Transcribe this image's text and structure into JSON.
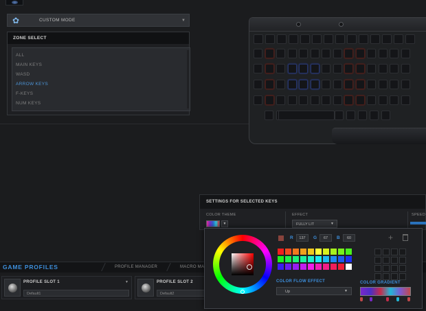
{
  "mode": {
    "label": "CUSTOM MODE"
  },
  "zones": {
    "title": "ZONE SELECT",
    "items": [
      {
        "label": "ALL",
        "active": false
      },
      {
        "label": "MAIN KEYS",
        "active": false
      },
      {
        "label": "WASD",
        "active": false
      },
      {
        "label": "ARROW KEYS",
        "active": true
      },
      {
        "label": "F-KEYS",
        "active": false
      },
      {
        "label": "NUM KEYS",
        "active": false
      }
    ]
  },
  "settings": {
    "title": "SETTINGS FOR SELECTED KEYS",
    "color_theme_label": "COLOR THEME",
    "effect_label": "EFFECT",
    "effect_value": "FULLY LIT",
    "speed_label": "SPEED"
  },
  "picker": {
    "current_color": "#89433c",
    "r_label": "R",
    "r": "137",
    "g_label": "G",
    "g": "67",
    "b_label": "B",
    "b": "60",
    "flow_label": "COLOR FLOW EFFECT",
    "flow_value": "Up",
    "gradient_label": "COLOR GRADIENT",
    "gradient_stops": [
      "#c0484a",
      "#7a27c9",
      "#c42c4a",
      "#22b7d6",
      "#c0484a"
    ],
    "palette": [
      "#f01e1e",
      "#f04a1e",
      "#f0781e",
      "#f0a01e",
      "#f0c81e",
      "#ffff3a",
      "#d8f01e",
      "#a8f01e",
      "#78f01e",
      "#4af01e",
      "#1ef01e",
      "#1ef04a",
      "#1ef078",
      "#1ef0a0",
      "#1ef0c8",
      "#1ee8f0",
      "#1eb8f0",
      "#1e88f0",
      "#1e5af0",
      "#1e2ef0",
      "#3a1ef0",
      "#6a1ef0",
      "#961ef0",
      "#c21ef0",
      "#f01ee8",
      "#f01eb8",
      "#f01e88",
      "#f01e5a",
      "#f01e36",
      "#ffffff"
    ]
  },
  "profiles": {
    "title": "GAME PROFILES",
    "tabs": [
      "PROFILE MANAGER",
      "MACRO MANA"
    ],
    "slots": [
      {
        "name": "PROFILE SLOT 1",
        "value": "Default1"
      },
      {
        "name": "PROFILE SLOT 2",
        "value": "Default2"
      }
    ]
  }
}
